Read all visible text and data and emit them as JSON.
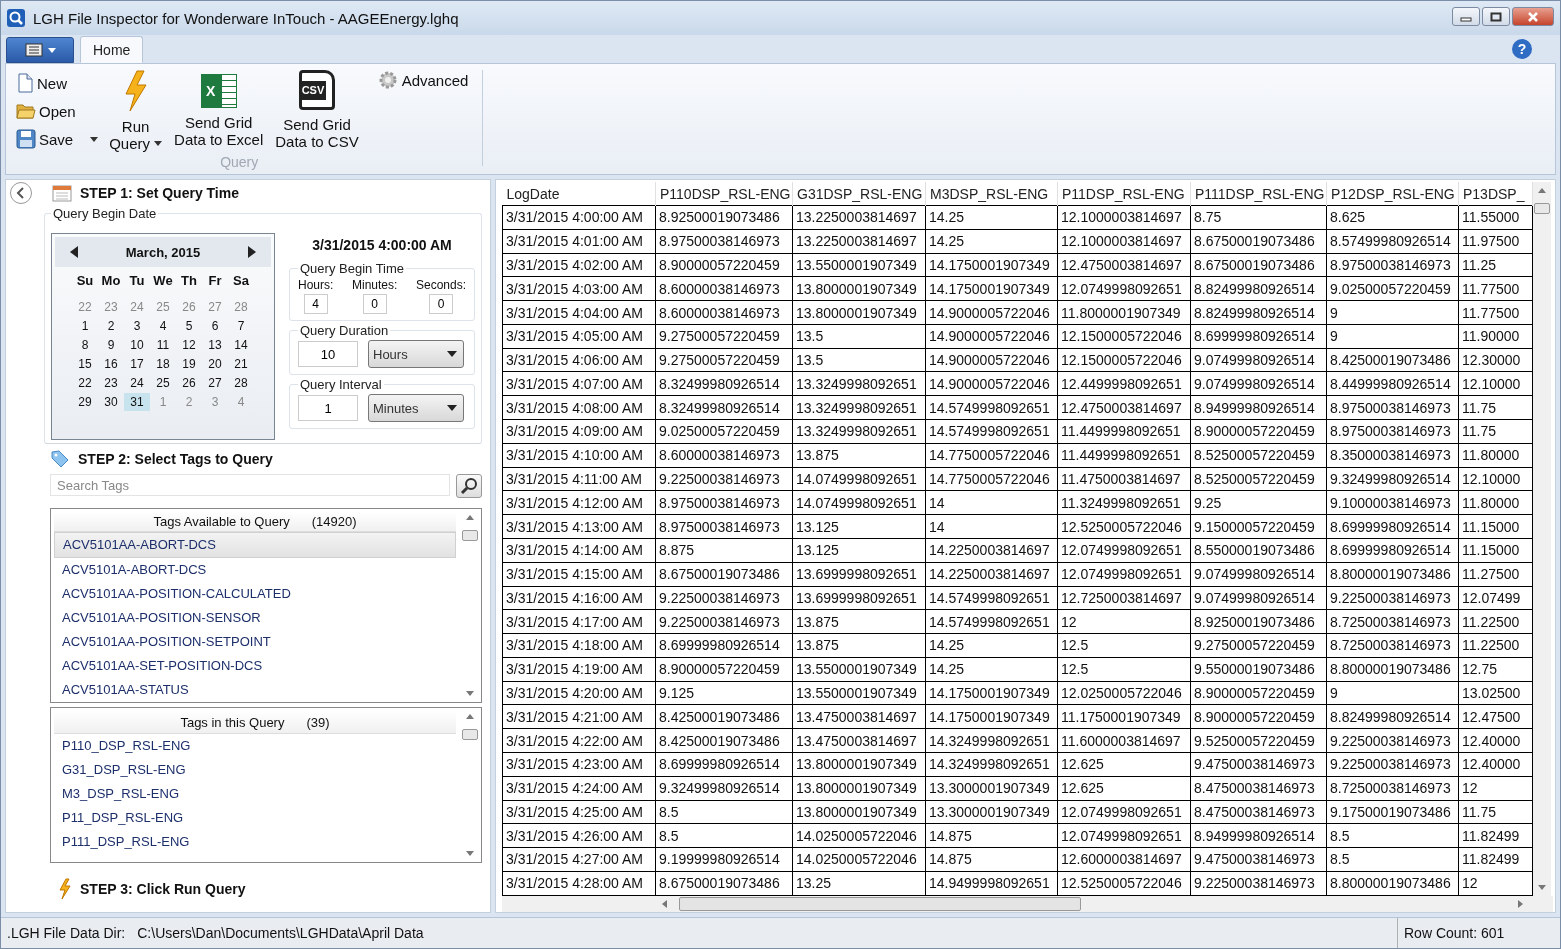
{
  "window": {
    "title": "LGH File Inspector for Wonderware InTouch - AAGEEnergy.lghq"
  },
  "tabs": [
    {
      "label": "Home",
      "selected": true
    }
  ],
  "help_button": "?",
  "ribbon": {
    "group_label": "Query",
    "advanced": "Advanced",
    "small_buttons": [
      {
        "kind": "new",
        "label": "New",
        "has_menu": false
      },
      {
        "kind": "open",
        "label": "Open",
        "has_menu": false
      },
      {
        "kind": "save",
        "label": "Save",
        "has_menu": true
      }
    ],
    "large_buttons": [
      {
        "kind": "run",
        "lines": [
          "Run",
          "Query"
        ],
        "has_menu": true
      },
      {
        "kind": "excel",
        "lines": [
          "Send Grid",
          "Data to Excel"
        ],
        "badge": "X",
        "has_menu": false
      },
      {
        "kind": "csv",
        "lines": [
          "Send Grid",
          "Data to CSV"
        ],
        "badge": "CSV",
        "has_menu": false
      }
    ]
  },
  "step1": {
    "title": "STEP 1: Set Query Time",
    "date_group": "Query Begin Date",
    "calendar": {
      "month": "March, 2015",
      "weekdays": [
        "Su",
        "Mo",
        "Tu",
        "We",
        "Th",
        "Fr",
        "Sa"
      ],
      "weeks": [
        [
          {
            "day": "22",
            "other_month": true,
            "selected": false
          },
          {
            "day": "23",
            "other_month": true,
            "selected": false
          },
          {
            "day": "24",
            "other_month": true,
            "selected": false
          },
          {
            "day": "25",
            "other_month": true,
            "selected": false
          },
          {
            "day": "26",
            "other_month": true,
            "selected": false
          },
          {
            "day": "27",
            "other_month": true,
            "selected": false
          },
          {
            "day": "28",
            "other_month": true,
            "selected": false
          }
        ],
        [
          {
            "day": "1",
            "other_month": false,
            "selected": false
          },
          {
            "day": "2",
            "other_month": false,
            "selected": false
          },
          {
            "day": "3",
            "other_month": false,
            "selected": false
          },
          {
            "day": "4",
            "other_month": false,
            "selected": false
          },
          {
            "day": "5",
            "other_month": false,
            "selected": false
          },
          {
            "day": "6",
            "other_month": false,
            "selected": false
          },
          {
            "day": "7",
            "other_month": false,
            "selected": false
          }
        ],
        [
          {
            "day": "8",
            "other_month": false,
            "selected": false
          },
          {
            "day": "9",
            "other_month": false,
            "selected": false
          },
          {
            "day": "10",
            "other_month": false,
            "selected": false
          },
          {
            "day": "11",
            "other_month": false,
            "selected": false
          },
          {
            "day": "12",
            "other_month": false,
            "selected": false
          },
          {
            "day": "13",
            "other_month": false,
            "selected": false
          },
          {
            "day": "14",
            "other_month": false,
            "selected": false
          }
        ],
        [
          {
            "day": "15",
            "other_month": false,
            "selected": false
          },
          {
            "day": "16",
            "other_month": false,
            "selected": false
          },
          {
            "day": "17",
            "other_month": false,
            "selected": false
          },
          {
            "day": "18",
            "other_month": false,
            "selected": false
          },
          {
            "day": "19",
            "other_month": false,
            "selected": false
          },
          {
            "day": "20",
            "other_month": false,
            "selected": false
          },
          {
            "day": "21",
            "other_month": false,
            "selected": false
          }
        ],
        [
          {
            "day": "22",
            "other_month": false,
            "selected": false
          },
          {
            "day": "23",
            "other_month": false,
            "selected": false
          },
          {
            "day": "24",
            "other_month": false,
            "selected": false
          },
          {
            "day": "25",
            "other_month": false,
            "selected": false
          },
          {
            "day": "26",
            "other_month": false,
            "selected": false
          },
          {
            "day": "27",
            "other_month": false,
            "selected": false
          },
          {
            "day": "28",
            "other_month": false,
            "selected": false
          }
        ],
        [
          {
            "day": "29",
            "other_month": false,
            "selected": false
          },
          {
            "day": "30",
            "other_month": false,
            "selected": false
          },
          {
            "day": "31",
            "other_month": false,
            "selected": true
          },
          {
            "day": "1",
            "other_month": true,
            "selected": false
          },
          {
            "day": "2",
            "other_month": true,
            "selected": false
          },
          {
            "day": "3",
            "other_month": true,
            "selected": false
          },
          {
            "day": "4",
            "other_month": true,
            "selected": false
          }
        ]
      ]
    },
    "selected_datetime": "3/31/2015 4:00:00 AM",
    "begin_time": {
      "label": "Query Begin Time",
      "fields": [
        {
          "label": "Hours:",
          "value": "4"
        },
        {
          "label": "Minutes:",
          "value": "0"
        },
        {
          "label": "Seconds:",
          "value": "0"
        }
      ]
    },
    "duration": {
      "label": "Query Duration",
      "value": "10",
      "unit": "Hours"
    },
    "interval": {
      "label": "Query Interval",
      "value": "1",
      "unit": "Minutes"
    }
  },
  "step2": {
    "title": "STEP 2: Select Tags to Query",
    "search": {
      "placeholder": "Search Tags"
    },
    "available": {
      "header": "Tags Available to Query",
      "count": "(14920)",
      "items": [
        {
          "label": "ACV5101AA-ABORT-DCS",
          "selected": true
        },
        {
          "label": "ACV5101A-ABORT-DCS",
          "selected": false
        },
        {
          "label": "ACV5101AA-POSITION-CALCULATED",
          "selected": false
        },
        {
          "label": "ACV5101AA-POSITION-SENSOR",
          "selected": false
        },
        {
          "label": "ACV5101AA-POSITION-SETPOINT",
          "selected": false
        },
        {
          "label": "ACV5101AA-SET-POSITION-DCS",
          "selected": false
        },
        {
          "label": "ACV5101AA-STATUS",
          "selected": false
        }
      ]
    },
    "in_query": {
      "header": "Tags in this Query",
      "count": "(39)",
      "items": [
        {
          "label": "P110_DSP_RSL-ENG",
          "selected": false
        },
        {
          "label": "G31_DSP_RSL-ENG",
          "selected": false
        },
        {
          "label": "M3_DSP_RSL-ENG",
          "selected": false
        },
        {
          "label": "P11_DSP_RSL-ENG",
          "selected": false
        },
        {
          "label": "P111_DSP_RSL-ENG",
          "selected": false
        }
      ]
    }
  },
  "step3": {
    "title": "STEP 3: Click Run Query"
  },
  "table": {
    "columns": [
      "LogDate",
      "P110DSP_RSL-ENG",
      "G31DSP_RSL-ENG",
      "M3DSP_RSL-ENG",
      "P11DSP_RSL-ENG",
      "P111DSP_RSL-ENG",
      "P12DSP_RSL-ENG",
      "P13DSP_"
    ],
    "rows": [
      [
        "3/31/2015 4:00:00 AM",
        "8.92500019073486",
        "13.2250003814697",
        "14.25",
        "12.1000003814697",
        "8.75",
        "8.625",
        "11.55000"
      ],
      [
        "3/31/2015 4:01:00 AM",
        "8.97500038146973",
        "13.2250003814697",
        "14.25",
        "12.1000003814697",
        "8.67500019073486",
        "8.57499980926514",
        "11.97500"
      ],
      [
        "3/31/2015 4:02:00 AM",
        "8.90000057220459",
        "13.5500001907349",
        "14.1750001907349",
        "12.4750003814697",
        "8.67500019073486",
        "8.97500038146973",
        "11.25"
      ],
      [
        "3/31/2015 4:03:00 AM",
        "8.60000038146973",
        "13.8000001907349",
        "14.1750001907349",
        "12.0749998092651",
        "8.82499980926514",
        "9.02500057220459",
        "11.77500"
      ],
      [
        "3/31/2015 4:04:00 AM",
        "8.60000038146973",
        "13.8000001907349",
        "14.9000005722046",
        "11.8000001907349",
        "8.82499980926514",
        "9",
        "11.77500"
      ],
      [
        "3/31/2015 4:05:00 AM",
        "9.27500057220459",
        "13.5",
        "14.9000005722046",
        "12.1500005722046",
        "8.69999980926514",
        "9",
        "11.90000"
      ],
      [
        "3/31/2015 4:06:00 AM",
        "9.27500057220459",
        "13.5",
        "14.9000005722046",
        "12.1500005722046",
        "9.07499980926514",
        "8.42500019073486",
        "12.30000"
      ],
      [
        "3/31/2015 4:07:00 AM",
        "8.32499980926514",
        "13.3249998092651",
        "14.9000005722046",
        "12.4499998092651",
        "9.07499980926514",
        "8.44999980926514",
        "12.10000"
      ],
      [
        "3/31/2015 4:08:00 AM",
        "8.32499980926514",
        "13.3249998092651",
        "14.5749998092651",
        "12.4750003814697",
        "8.94999980926514",
        "8.97500038146973",
        "11.75"
      ],
      [
        "3/31/2015 4:09:00 AM",
        "9.02500057220459",
        "13.3249998092651",
        "14.5749998092651",
        "11.4499998092651",
        "8.90000057220459",
        "8.97500038146973",
        "11.75"
      ],
      [
        "3/31/2015 4:10:00 AM",
        "8.60000038146973",
        "13.875",
        "14.7750005722046",
        "11.4499998092651",
        "8.52500057220459",
        "8.35000038146973",
        "11.80000"
      ],
      [
        "3/31/2015 4:11:00 AM",
        "9.22500038146973",
        "14.0749998092651",
        "14.7750005722046",
        "11.4750003814697",
        "8.52500057220459",
        "9.32499980926514",
        "12.10000"
      ],
      [
        "3/31/2015 4:12:00 AM",
        "8.97500038146973",
        "14.0749998092651",
        "14",
        "11.3249998092651",
        "9.25",
        "9.10000038146973",
        "11.80000"
      ],
      [
        "3/31/2015 4:13:00 AM",
        "8.97500038146973",
        "13.125",
        "14",
        "12.5250005722046",
        "9.15000057220459",
        "8.69999980926514",
        "11.15000"
      ],
      [
        "3/31/2015 4:14:00 AM",
        "8.875",
        "13.125",
        "14.2250003814697",
        "12.0749998092651",
        "8.55000019073486",
        "8.69999980926514",
        "11.15000"
      ],
      [
        "3/31/2015 4:15:00 AM",
        "8.67500019073486",
        "13.6999998092651",
        "14.2250003814697",
        "12.0749998092651",
        "9.07499980926514",
        "8.80000019073486",
        "11.27500"
      ],
      [
        "3/31/2015 4:16:00 AM",
        "9.22500038146973",
        "13.6999998092651",
        "14.5749998092651",
        "12.7250003814697",
        "9.07499980926514",
        "9.22500038146973",
        "12.07499"
      ],
      [
        "3/31/2015 4:17:00 AM",
        "9.22500038146973",
        "13.875",
        "14.5749998092651",
        "12",
        "8.92500019073486",
        "8.72500038146973",
        "11.22500"
      ],
      [
        "3/31/2015 4:18:00 AM",
        "8.69999980926514",
        "13.875",
        "14.25",
        "12.5",
        "9.27500057220459",
        "8.72500038146973",
        "11.22500"
      ],
      [
        "3/31/2015 4:19:00 AM",
        "8.90000057220459",
        "13.5500001907349",
        "14.25",
        "12.5",
        "9.55000019073486",
        "8.80000019073486",
        "12.75"
      ],
      [
        "3/31/2015 4:20:00 AM",
        "9.125",
        "13.5500001907349",
        "14.1750001907349",
        "12.0250005722046",
        "8.90000057220459",
        "9",
        "13.02500"
      ],
      [
        "3/31/2015 4:21:00 AM",
        "8.42500019073486",
        "13.4750003814697",
        "14.1750001907349",
        "11.1750001907349",
        "8.90000057220459",
        "8.82499980926514",
        "12.47500"
      ],
      [
        "3/31/2015 4:22:00 AM",
        "8.42500019073486",
        "13.4750003814697",
        "14.3249998092651",
        "11.6000003814697",
        "9.52500057220459",
        "9.22500038146973",
        "12.40000"
      ],
      [
        "3/31/2015 4:23:00 AM",
        "8.69999980926514",
        "13.8000001907349",
        "14.3249998092651",
        "12.625",
        "9.47500038146973",
        "9.22500038146973",
        "12.40000"
      ],
      [
        "3/31/2015 4:24:00 AM",
        "9.32499980926514",
        "13.8000001907349",
        "13.3000001907349",
        "12.625",
        "8.47500038146973",
        "8.72500038146973",
        "12"
      ],
      [
        "3/31/2015 4:25:00 AM",
        "8.5",
        "13.8000001907349",
        "13.3000001907349",
        "12.0749998092651",
        "8.47500038146973",
        "9.17500019073486",
        "11.75"
      ],
      [
        "3/31/2015 4:26:00 AM",
        "8.5",
        "14.0250005722046",
        "14.875",
        "12.0749998092651",
        "8.94999980926514",
        "8.5",
        "11.82499"
      ],
      [
        "3/31/2015 4:27:00 AM",
        "9.19999980926514",
        "14.0250005722046",
        "14.875",
        "12.6000003814697",
        "9.47500038146973",
        "8.5",
        "11.82499"
      ],
      [
        "3/31/2015 4:28:00 AM",
        "8.67500019073486",
        "13.25",
        "14.9499998092651",
        "12.5250005722046",
        "9.22500038146973",
        "8.80000019073486",
        "12"
      ]
    ]
  },
  "status_bar": {
    "dir_label": ".LGH File Data Dir:",
    "dir_value": "C:\\Users\\Dan\\Documents\\LGHData\\April Data",
    "row_count": "Row Count: 601"
  }
}
